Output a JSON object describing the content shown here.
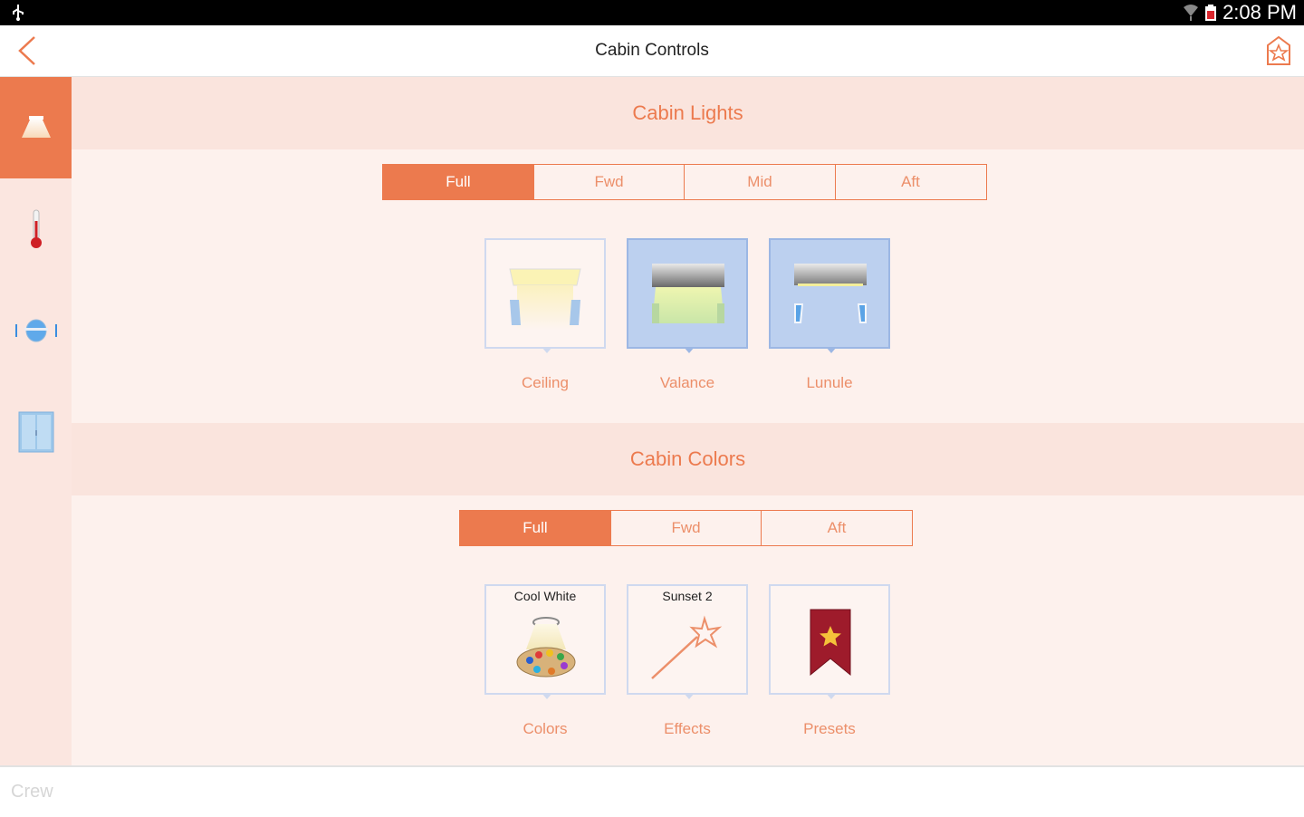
{
  "status_bar": {
    "time": "2:08 PM"
  },
  "app_bar": {
    "title": "Cabin Controls"
  },
  "sidebar": {
    "items": [
      {
        "name": "lights",
        "icon": "ceiling-light-icon",
        "active": true
      },
      {
        "name": "temperature",
        "icon": "thermometer-icon",
        "active": false
      },
      {
        "name": "seat",
        "icon": "seat-icon",
        "active": false
      },
      {
        "name": "window",
        "icon": "window-shade-icon",
        "active": false
      }
    ]
  },
  "lights": {
    "title": "Cabin Lights",
    "zones": [
      "Full",
      "Fwd",
      "Mid",
      "Aft"
    ],
    "selected_zone": "Full",
    "tiles": [
      {
        "label": "Ceiling",
        "on": false
      },
      {
        "label": "Valance",
        "on": true
      },
      {
        "label": "Lunule",
        "on": true
      }
    ]
  },
  "colors": {
    "title": "Cabin Colors",
    "zones": [
      "Full",
      "Fwd",
      "Aft"
    ],
    "selected_zone": "Full",
    "tiles": [
      {
        "label": "Colors",
        "top_text": "Cool White",
        "icon": "palette-icon"
      },
      {
        "label": "Effects",
        "top_text": "Sunset 2",
        "icon": "magic-wand-icon"
      },
      {
        "label": "Presets",
        "top_text": "",
        "icon": "bookmark-star-icon"
      }
    ]
  },
  "bottom_bar": {
    "label": "Crew"
  },
  "theme": {
    "accent": "#ec7a4e",
    "tile_on": "#bcd0ef",
    "panel": "#fdf1ed",
    "band": "#fae4dd"
  }
}
